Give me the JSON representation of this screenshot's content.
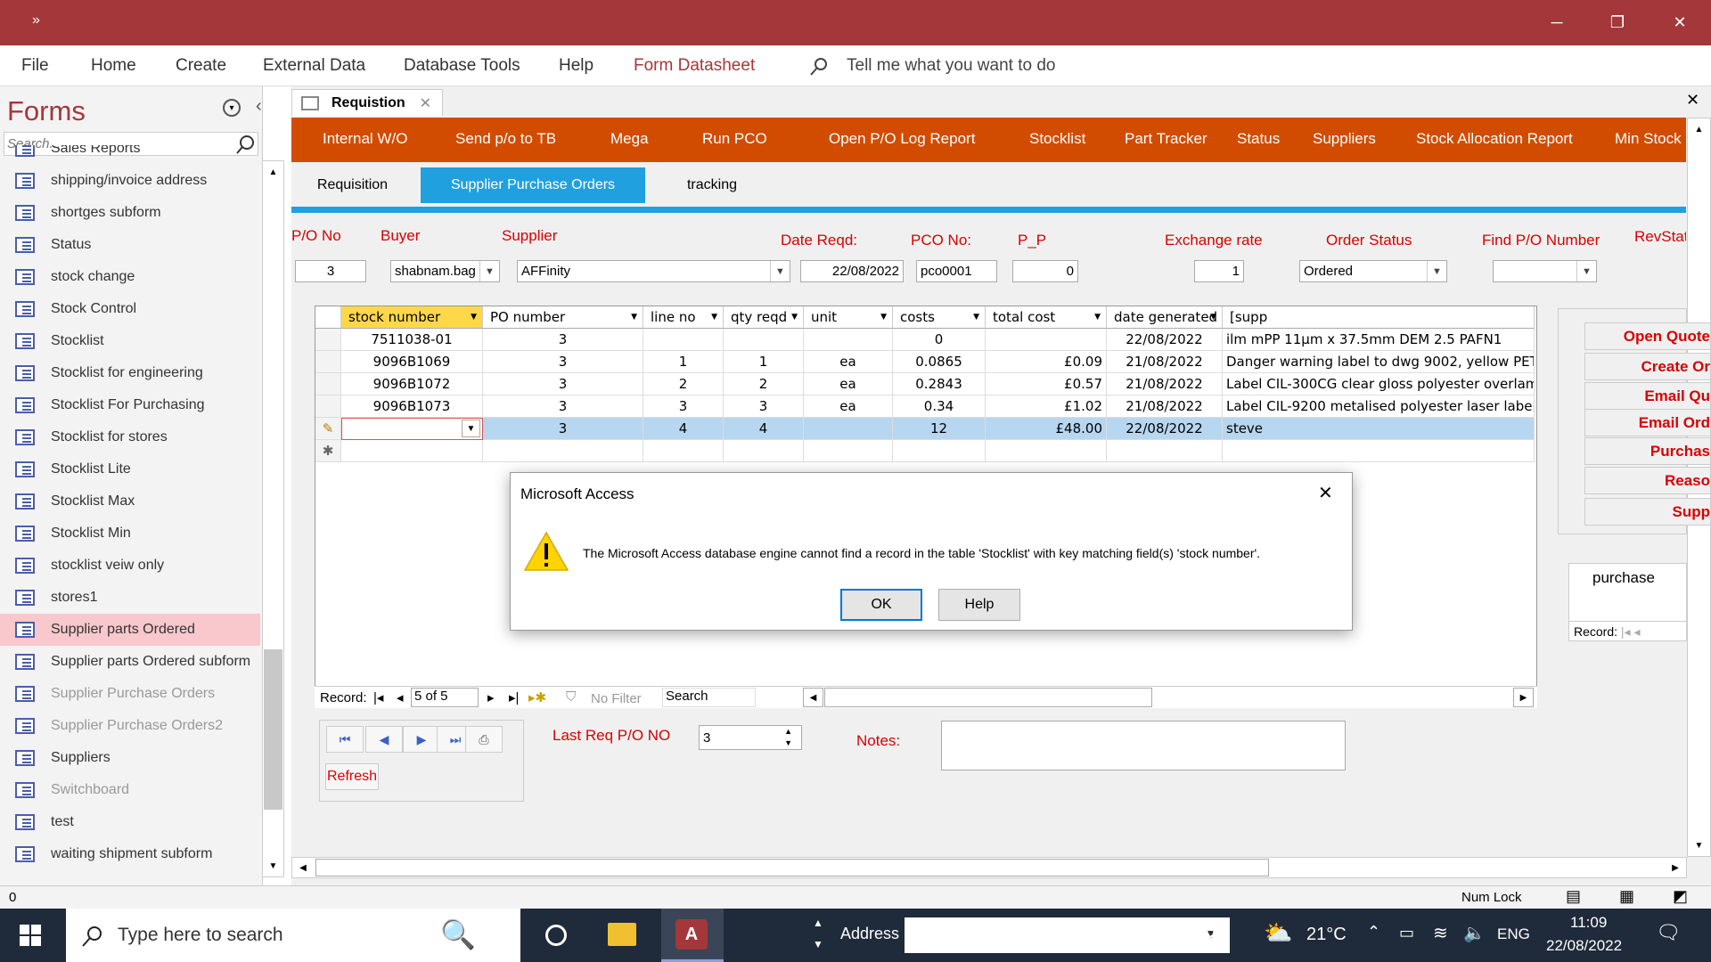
{
  "titlebar": {
    "quick_access": "»",
    "minimize": "─",
    "restore": "❐",
    "close": "✕"
  },
  "ribbon": {
    "tabs": [
      "File",
      "Home",
      "Create",
      "External Data",
      "Database Tools",
      "Help",
      "Form Datasheet"
    ],
    "tell_me": "Tell me what you want to do"
  },
  "nav": {
    "title": "Forms",
    "search_placeholder": "Search...",
    "items": [
      {
        "label": "Sales Reports",
        "state": "normal"
      },
      {
        "label": "shipping/invoice address",
        "state": "normal"
      },
      {
        "label": "shortges subform",
        "state": "normal"
      },
      {
        "label": "Status",
        "state": "normal"
      },
      {
        "label": "stock change",
        "state": "normal"
      },
      {
        "label": "Stock Control",
        "state": "normal"
      },
      {
        "label": "Stocklist",
        "state": "normal"
      },
      {
        "label": "Stocklist for engineering",
        "state": "normal"
      },
      {
        "label": "Stocklist For Purchasing",
        "state": "normal"
      },
      {
        "label": "Stocklist for stores",
        "state": "normal"
      },
      {
        "label": "Stocklist Lite",
        "state": "normal"
      },
      {
        "label": "Stocklist Max",
        "state": "normal"
      },
      {
        "label": "Stocklist Min",
        "state": "normal"
      },
      {
        "label": "stocklist veiw only",
        "state": "normal"
      },
      {
        "label": "stores1",
        "state": "normal"
      },
      {
        "label": "Supplier parts Ordered",
        "state": "selected"
      },
      {
        "label": "Supplier parts Ordered subform",
        "state": "normal"
      },
      {
        "label": "Supplier Purchase Orders",
        "state": "dim"
      },
      {
        "label": "Supplier Purchase Orders2",
        "state": "dim"
      },
      {
        "label": "Suppliers",
        "state": "normal"
      },
      {
        "label": "Switchboard",
        "state": "dim"
      },
      {
        "label": "test",
        "state": "normal"
      },
      {
        "label": "waiting shipment subform",
        "state": "normal"
      }
    ]
  },
  "doc_tab": {
    "label": "Requistion"
  },
  "toolbar": [
    "Internal W/O",
    "Send p/o to TB",
    "Mega",
    "Run PCO",
    "Open P/O Log Report",
    "Stocklist",
    "Part Tracker",
    "Status",
    "Suppliers",
    "Stock Allocation Report",
    "Min Stock"
  ],
  "form_tabs": [
    {
      "label": "Requisition",
      "active": false
    },
    {
      "label": "Supplier Purchase Orders",
      "active": true
    },
    {
      "label": "tracking",
      "active": false
    }
  ],
  "header_labels": {
    "po_no": "P/O No",
    "buyer": "Buyer",
    "supplier": "Supplier",
    "date_reqd": "Date Reqd:",
    "pco_no": "PCO No:",
    "pp": "P_P",
    "exchange_rate": "Exchange rate",
    "order_status": "Order Status",
    "find_po": "Find P/O Number",
    "revstat": "RevStat"
  },
  "header_values": {
    "po_no": "3",
    "buyer": "shabnam.bag",
    "supplier": "AFFinity",
    "date_reqd": "22/08/2022",
    "pco_no": "pco0001",
    "pp": "0",
    "exchange_rate": "1",
    "order_status": "Ordered",
    "find_po": ""
  },
  "grid": {
    "columns": [
      "stock number",
      "PO number",
      "line no",
      "qty reqd",
      "unit",
      "costs",
      "total cost",
      "date generated",
      "[supp"
    ],
    "rows": [
      [
        "7511038-01",
        "3",
        "",
        "",
        "",
        "0",
        "",
        "22/08/2022",
        "ilm mPP 11µm x 37.5mm DEM 2.5 PAFN1"
      ],
      [
        "9096B1069",
        "3",
        "1",
        "1",
        "ea",
        "0.0865",
        "£0.09",
        "21/08/2022",
        "Danger warning label to dwg 9002, yellow PET/"
      ],
      [
        "9096B1072",
        "3",
        "2",
        "2",
        "ea",
        "0.2843",
        "£0.57",
        "21/08/2022",
        "Label CIL-300CG clear gloss polyester overlam"
      ],
      [
        "9096B1073",
        "3",
        "3",
        "3",
        "ea",
        "0.34",
        "£1.02",
        "21/08/2022",
        "Label CIL-9200 metalised polyester laser label"
      ],
      [
        "",
        "3",
        "4",
        "4",
        "",
        "12",
        "£48.00",
        "22/08/2022",
        "steve"
      ]
    ],
    "record_nav": {
      "label": "Record:",
      "current": "5 of 5",
      "no_filter": "No Filter",
      "search": "Search"
    }
  },
  "bottom": {
    "refresh": "Refresh",
    "last_req_label": "Last Req P/O NO",
    "last_req_value": "3",
    "notes_label": "Notes:"
  },
  "side_buttons": [
    "Open Quote",
    "Create Or",
    "Email Qu",
    "Email Ord",
    "Purchas",
    "Reaso",
    "Supp"
  ],
  "side_subform": {
    "header": "purchase",
    "record_label": "Record:"
  },
  "dialog": {
    "title": "Microsoft Access",
    "message": "The Microsoft Access database engine cannot find a record in the table 'Stocklist' with key matching field(s) 'stock number'.",
    "ok": "OK",
    "help": "Help",
    "close": "✕"
  },
  "statusbar": {
    "left": "0",
    "num_lock": "Num Lock"
  },
  "taskbar": {
    "search_placeholder": "Type here to search",
    "address_label": "Address",
    "weather": "21°C",
    "language": "ENG",
    "time": "11:09",
    "date": "22/08/2022"
  },
  "colors": {
    "title_red": "#a4373a",
    "toolbar_orange": "#d24c00",
    "tab_blue": "#21a0e0",
    "label_red": "#d80000",
    "selected_nav": "#f8c8cc"
  }
}
